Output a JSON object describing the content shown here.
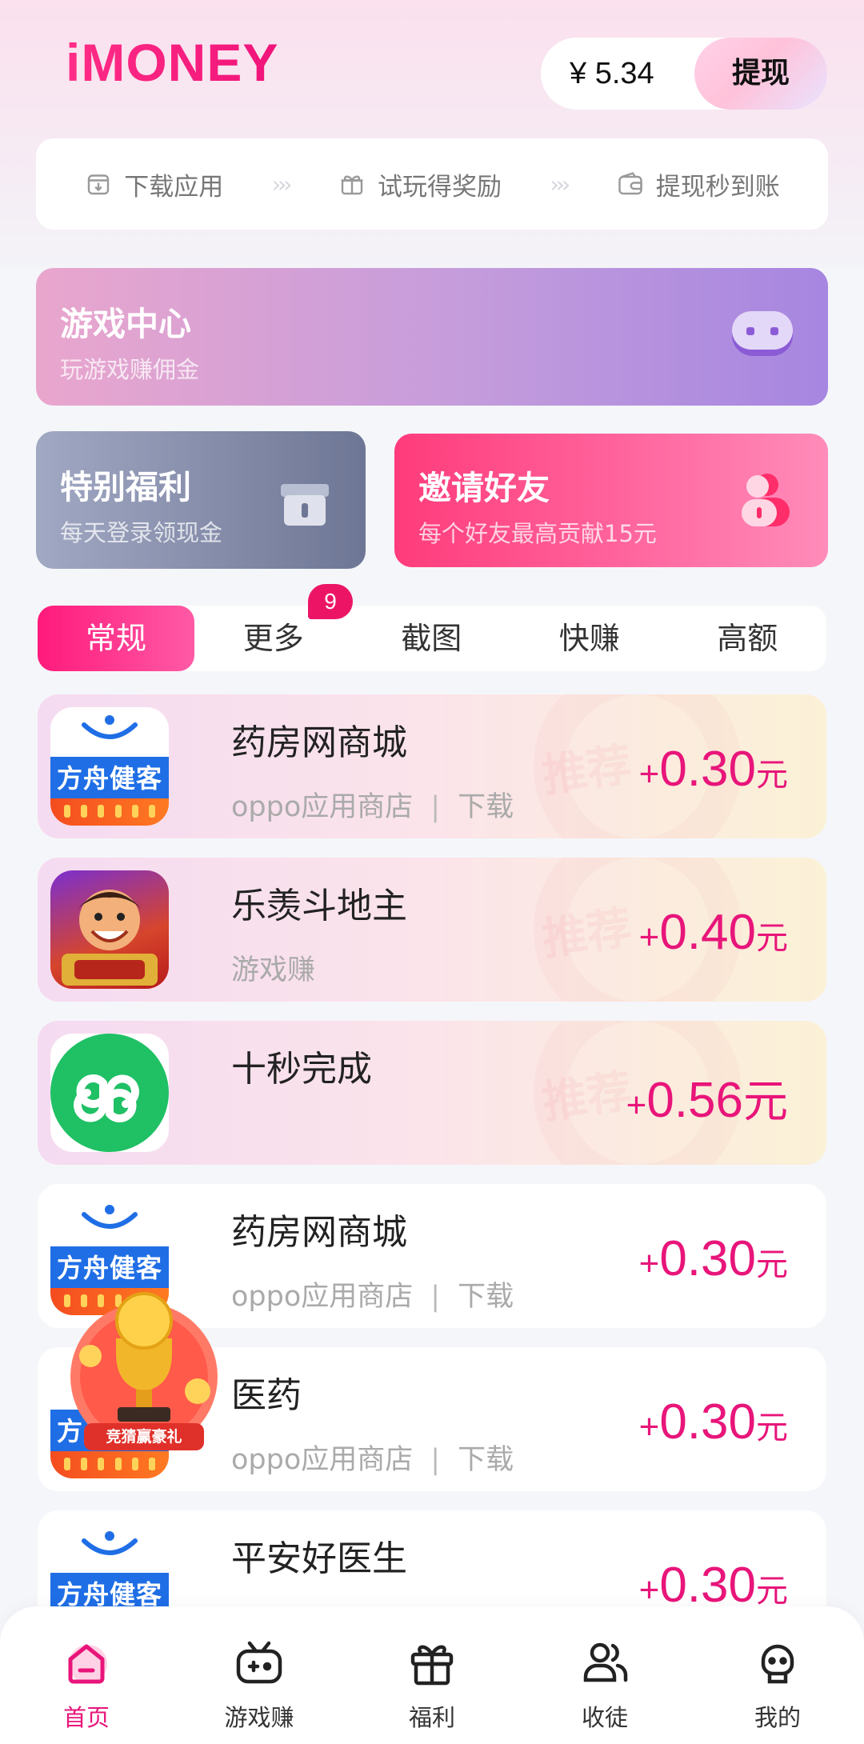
{
  "header": {
    "logo": "iMONEY",
    "balance": "¥  5.34",
    "withdraw_label": "提现"
  },
  "steps": [
    {
      "label": "下载应用",
      "icon": "download-box-icon"
    },
    {
      "label": "试玩得奖励",
      "icon": "gift-icon"
    },
    {
      "label": "提现秒到账",
      "icon": "wallet-icon"
    }
  ],
  "step_arrow": "›››",
  "cards": {
    "game": {
      "title": "游戏中心",
      "subtitle": "玩游戏赚佣金"
    },
    "welfare": {
      "title": "特别福利",
      "subtitle": "每天登录领现金"
    },
    "invite": {
      "title": "邀请好友",
      "subtitle": "每个好友最高贡献15元"
    }
  },
  "tabs": [
    "常规",
    "更多",
    "截图",
    "快赚",
    "高额"
  ],
  "tab_badge": "9",
  "tasks": [
    {
      "name": "药房网商城",
      "source": "oppo应用商店",
      "action": "下载",
      "reward": "0.30",
      "recommended": true,
      "icon": "fangzhou"
    },
    {
      "name": "乐羡斗地主",
      "source": "游戏赚",
      "action": "",
      "reward": "0.40",
      "recommended": true,
      "icon": "doudizhu"
    },
    {
      "name": "十秒完成",
      "source": "",
      "action": "",
      "reward": "0.56",
      "recommended": true,
      "icon": "mini-program"
    },
    {
      "name": "药房网商城",
      "source": "oppo应用商店",
      "action": "下载",
      "reward": "0.30",
      "recommended": false,
      "icon": "fangzhou"
    },
    {
      "name": "医药",
      "source": "oppo应用商店",
      "action": "下载",
      "reward": "0.30",
      "recommended": false,
      "icon": "fangzhou"
    },
    {
      "name": "平安好医生",
      "source": "",
      "action": "",
      "reward": "0.30",
      "recommended": false,
      "icon": "fangzhou"
    }
  ],
  "task_icon_text": "方舟健客",
  "reward_plus": "+",
  "reward_unit": "元",
  "recommend_watermark": "推荐",
  "float_badge_label": "竞猜赢豪礼",
  "nav": [
    {
      "label": "首页",
      "icon": "home-icon",
      "active": true
    },
    {
      "label": "游戏赚",
      "icon": "gamepad-icon",
      "active": false
    },
    {
      "label": "福利",
      "icon": "gift-icon",
      "active": false
    },
    {
      "label": "收徒",
      "icon": "users-icon",
      "active": false
    },
    {
      "label": "我的",
      "icon": "profile-icon",
      "active": false
    }
  ],
  "colors": {
    "accent": "#e8157a",
    "tab_active": "#ff1a7b",
    "game_card": "#b89ade",
    "welfare_card": "#8a91ad",
    "invite_card": "#ff4f8d"
  }
}
